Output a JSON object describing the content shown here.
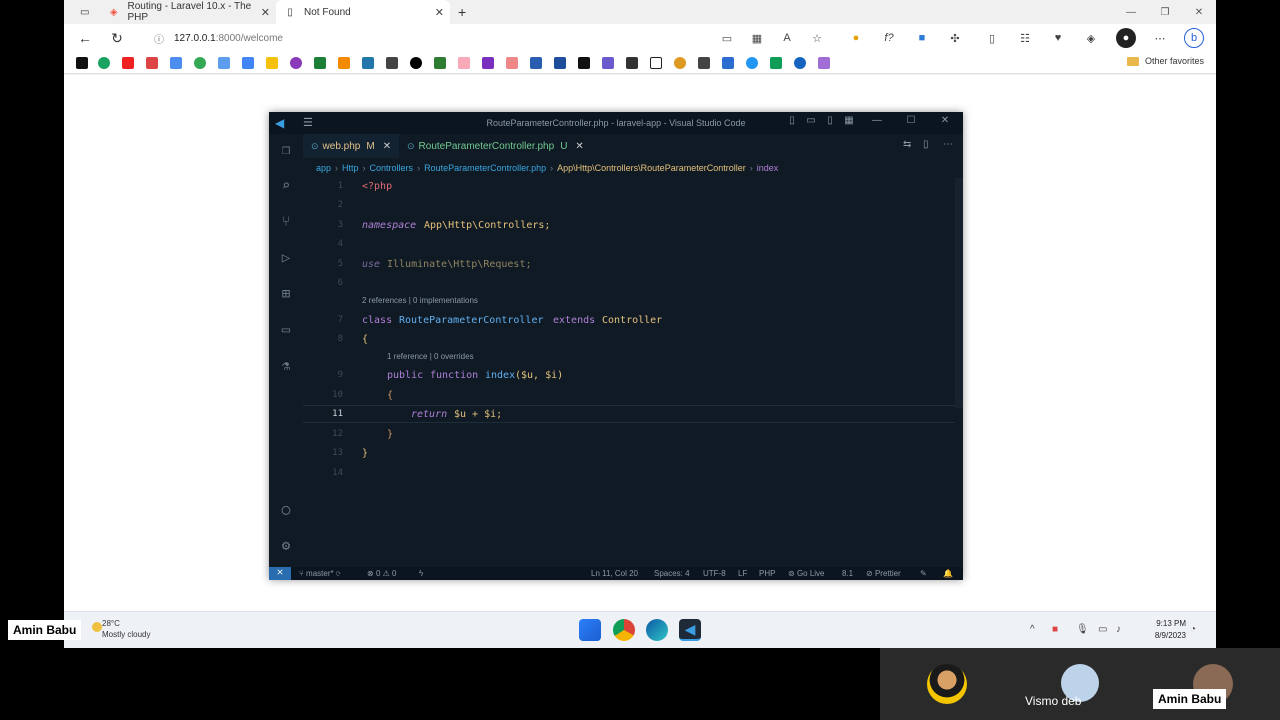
{
  "browser": {
    "tabs": [
      {
        "title": "Routing - Laravel 10.x - The PHP",
        "icon": "laravel-icon"
      },
      {
        "title": "Not Found",
        "icon": "page-icon"
      }
    ],
    "url_host": "127.0.0.1",
    "url_path": ":8000/welcome",
    "other_favorites": "Other favorites"
  },
  "vscode": {
    "title": "RouteParameterController.php - laravel-app - Visual Studio Code",
    "tabs": [
      {
        "name": "web.php",
        "status": "M"
      },
      {
        "name": "RouteParameterController.php",
        "status": "U"
      }
    ],
    "breadcrumb": [
      "app",
      "Http",
      "Controllers",
      "RouteParameterController.php",
      "App\\Http\\Controllers\\RouteParameterController",
      "index"
    ],
    "code": {
      "l1": "<?php",
      "l3_kw": "namespace",
      "l3_ns": "App\\Http\\Controllers;",
      "l5_kw": "use",
      "l5_ns": "Illuminate\\Http\\Request;",
      "lens1": "2 references | 0 implementations",
      "l7_class": "class",
      "l7_name": "RouteParameterController",
      "l7_ext": "extends",
      "l7_parent": "Controller",
      "l8": "{",
      "lens2": "1 reference | 0 overrides",
      "l9_pub": "public",
      "l9_fn": "function",
      "l9_name": "index",
      "l9_params": "($u, $i)",
      "l10": "{",
      "l11_ret": "return",
      "l11_expr": "$u + $i;",
      "l12": "}",
      "l13": "}"
    },
    "line_numbers": [
      "1",
      "2",
      "3",
      "4",
      "5",
      "6",
      "7",
      "8",
      "9",
      "10",
      "11",
      "12",
      "13",
      "14"
    ],
    "status": {
      "branch": "master*",
      "errors": "0",
      "warnings": "0",
      "position": "Ln 11, Col 20",
      "spaces": "Spaces: 4",
      "encoding": "UTF-8",
      "eol": "LF",
      "language": "PHP",
      "golive": "Go Live",
      "version": "8.1",
      "prettier": "Prettier"
    }
  },
  "taskbar": {
    "temp": "28°C",
    "weather": "Mostly cloudy",
    "time": "9:13 PM",
    "date": "8/9/2023"
  },
  "participants": {
    "left_label": "Amin Babu",
    "p2": "Vismo deb",
    "p3": "Amin Babu"
  }
}
